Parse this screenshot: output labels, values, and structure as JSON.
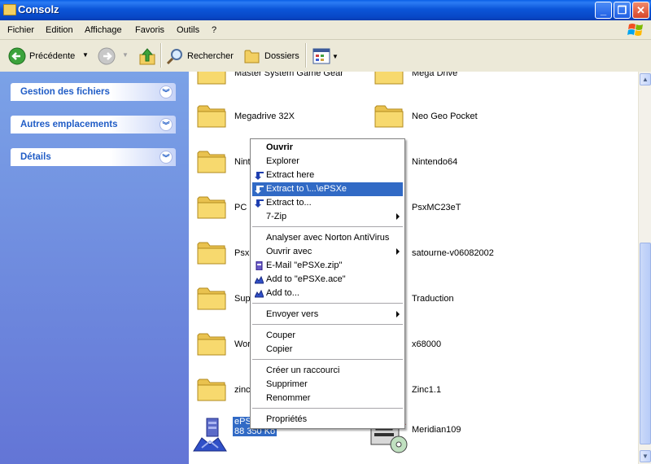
{
  "window": {
    "title": "Consolz"
  },
  "menubar": {
    "items": [
      "Fichier",
      "Edition",
      "Affichage",
      "Favoris",
      "Outils",
      "?"
    ]
  },
  "toolbar": {
    "back_label": "Précédente",
    "search_label": "Rechercher",
    "folders_label": "Dossiers"
  },
  "taskpane": {
    "sections": [
      "Gestion des fichiers",
      "Autres emplacements",
      "Détails"
    ]
  },
  "files": {
    "left": [
      "Master System Game Gear",
      "Megadrive 32X",
      "Ninte",
      "PC E",
      "Psxl",
      "Sup",
      "Wor",
      "zinc"
    ],
    "right": [
      "Mega Drive",
      "Neo Geo Pocket",
      "Nintendo64",
      "PsxMC23eT",
      "satourne-v06082002",
      "Traduction",
      "x68000",
      "Zinc1.1"
    ],
    "selected": {
      "name": "ePSXe",
      "size": "88 350 Ko"
    },
    "last_right": "Meridian109"
  },
  "context_menu": {
    "open": "Ouvrir",
    "explore": "Explorer",
    "extract_here": "Extract here",
    "extract_to_folder": "Extract to \\...\\ePSXe",
    "extract_to": "Extract to...",
    "sevenzip": "7-Zip",
    "norton": "Analyser avec Norton AntiVirus",
    "open_with": "Ouvrir avec",
    "email": "E-Mail \"ePSXe.zip\"",
    "add_to_ace": "Add to \"ePSXe.ace\"",
    "add_to": "Add to...",
    "send_to": "Envoyer vers",
    "cut": "Couper",
    "copy": "Copier",
    "shortcut": "Créer un raccourci",
    "delete": "Supprimer",
    "rename": "Renommer",
    "properties": "Propriétés"
  },
  "colors": {
    "title_blue": "#0a5fe6",
    "taskpane_blue": "#6e8fe0",
    "highlight": "#316ac5",
    "folder_yellow": "#f2cf62"
  }
}
